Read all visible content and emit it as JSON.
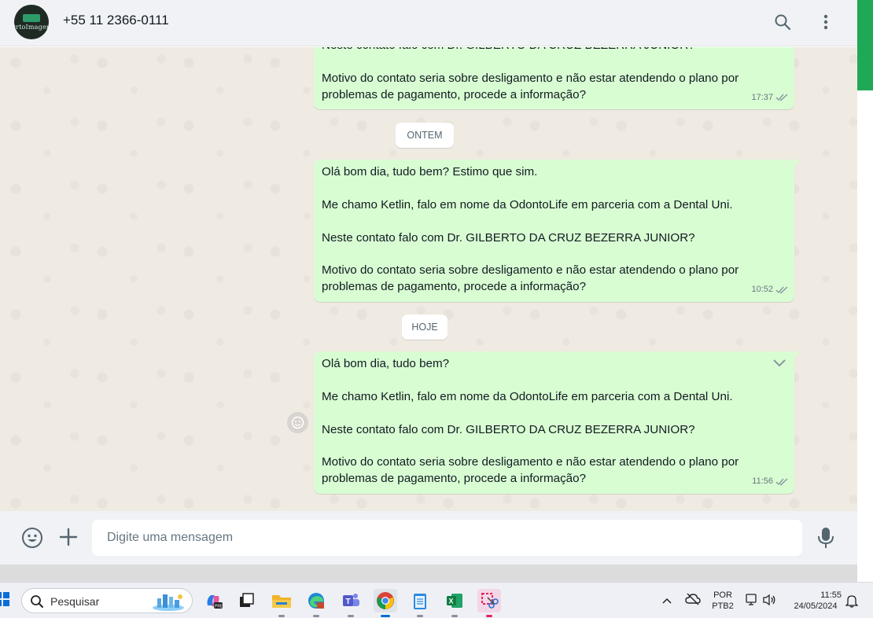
{
  "header": {
    "avatar_text": "OrtoImagem",
    "contact_name": "+55 11 2366-0111",
    "search_icon": "search-icon",
    "menu_icon": "more-vertical-icon"
  },
  "messages": [
    {
      "paragraphs": [
        "Neste contato falo com Dr. GILBERTO DA CRUZ BEZERRA JUNIOR?",
        "Motivo do contato seria sobre desligamento e não estar atendendo o plano por problemas de pagamento, procede a informação?"
      ],
      "time": "17:37",
      "status": "read"
    },
    {
      "paragraphs": [
        "Olá bom dia, tudo bem? Estimo que sim.",
        "Me chamo Ketlin, falo em nome da OdontoLife em parceria com a Dental Uni.",
        "Neste contato falo com Dr. GILBERTO DA CRUZ BEZERRA JUNIOR?",
        "Motivo do contato seria sobre desligamento e não estar atendendo o plano por problemas de pagamento, procede a informação?"
      ],
      "time": "10:52",
      "status": "read"
    },
    {
      "paragraphs": [
        "Olá bom dia, tudo bem?",
        "Me chamo Ketlin, falo em nome da OdontoLife em parceria com a Dental Uni.",
        "Neste contato falo com Dr. GILBERTO DA CRUZ BEZERRA JUNIOR?",
        "Motivo do contato seria sobre desligamento e não estar atendendo o plano por problemas de pagamento, procede a informação?"
      ],
      "time": "11:56",
      "status": "read"
    }
  ],
  "date_separators": [
    "ONTEM",
    "HOJE"
  ],
  "composer": {
    "placeholder": "Digite uma mensagem"
  },
  "taskbar": {
    "search_placeholder": "Pesquisar",
    "apps": [
      "copilot-icon",
      "task-view-icon",
      "file-explorer-icon",
      "edge-icon",
      "teams-icon",
      "chrome-icon",
      "notepad-icon",
      "excel-icon",
      "snipping-tool-icon"
    ],
    "language_top": "POR",
    "language_bottom": "PTB2",
    "time": "11:55",
    "date": "24/05/2024",
    "colors": {
      "accent": "#0a6cd6",
      "bubble": "#d9fdd3",
      "whatsapp_green": "#1fa855"
    }
  }
}
